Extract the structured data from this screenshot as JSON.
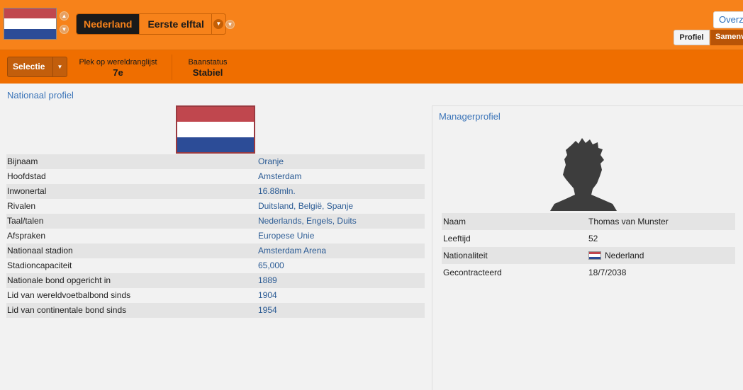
{
  "header": {
    "team_name": "Nederland",
    "squad": "Eerste elftal",
    "overview_tab": "Overz",
    "tabs": {
      "profile": "Profiel",
      "summary": "Samenv"
    }
  },
  "subbar": {
    "selection_label": "Selectie",
    "ranking_label": "Plek op wereldranglijst",
    "ranking_value": "7e",
    "job_status_label": "Baanstatus",
    "job_status_value": "Stabiel"
  },
  "national_profile": {
    "title": "Nationaal profiel",
    "rows": [
      {
        "key": "Bijnaam",
        "value": "Oranje"
      },
      {
        "key": "Hoofdstad",
        "value": "Amsterdam"
      },
      {
        "key": "Inwonertal",
        "value": "16.88mln."
      },
      {
        "key": "Rivalen",
        "value": "Duitsland, België, Spanje"
      },
      {
        "key": "Taal/talen",
        "value": "Nederlands, Engels, Duits"
      },
      {
        "key": "Afspraken",
        "value": "Europese Unie"
      },
      {
        "key": "Nationaal stadion",
        "value": "Amsterdam Arena"
      },
      {
        "key": "Stadioncapaciteit",
        "value": "65,000"
      },
      {
        "key": "Nationale bond opgericht in",
        "value": "1889"
      },
      {
        "key": "Lid van wereldvoetbalbond sinds",
        "value": "1904"
      },
      {
        "key": "Lid van continentale bond sinds",
        "value": "1954"
      }
    ]
  },
  "manager_profile": {
    "title": "Managerprofiel",
    "rows": [
      {
        "key": "Naam",
        "value": "Thomas van Munster"
      },
      {
        "key": "Leeftijd",
        "value": "52"
      },
      {
        "key": "Nationaliteit",
        "value": "Nederland"
      },
      {
        "key": "Gecontracteerd",
        "value": "18/7/2038"
      }
    ]
  },
  "colors": {
    "header_orange": "#f7821a",
    "subbar_orange": "#ef6e00",
    "link_blue": "#3b74b8",
    "flag_red": "#c0474e",
    "flag_white": "#ffffff",
    "flag_blue": "#2c4c97"
  }
}
